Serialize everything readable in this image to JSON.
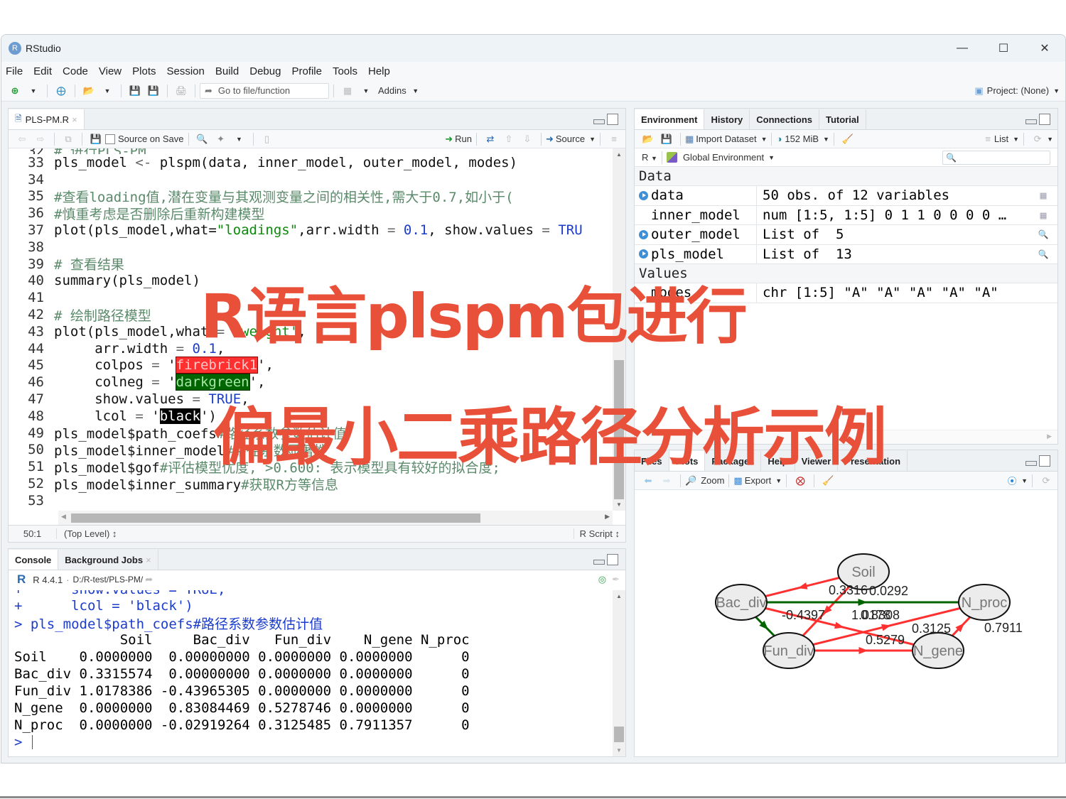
{
  "window": {
    "title": "RStudio",
    "controls": [
      "minimize",
      "maximize",
      "close"
    ]
  },
  "menu": [
    "File",
    "Edit",
    "Code",
    "View",
    "Plots",
    "Session",
    "Build",
    "Debug",
    "Profile",
    "Tools",
    "Help"
  ],
  "toolbar": {
    "goto_placeholder": "Go to file/function",
    "addins_label": "Addins",
    "project_label": "Project: (None)"
  },
  "editor": {
    "tab_label": "PLS-PM.R",
    "source_on_save": "Source on Save",
    "run_label": "Run",
    "source_label": "Source",
    "partial_first_line": "# 进行PLS-PM",
    "lines": [
      {
        "n": "33",
        "segments": [
          [
            "plain",
            "pls_model "
          ],
          [
            "op",
            "<-"
          ],
          [
            "plain",
            " plspm(data, inner_model, outer_model, modes)"
          ]
        ]
      },
      {
        "n": "34",
        "segments": []
      },
      {
        "n": "35",
        "segments": [
          [
            "com",
            "#查看loading值,潜在变量与其观测变量之间的相关性,需大于0.7,如小于("
          ]
        ]
      },
      {
        "n": "36",
        "segments": [
          [
            "com",
            "#慎重考虑是否删除后重新构建模型"
          ]
        ]
      },
      {
        "n": "37",
        "segments": [
          [
            "plain",
            "plot(pls_model,what="
          ],
          [
            "str",
            "\"loadings\""
          ],
          [
            "plain",
            ",arr.width "
          ],
          [
            "op",
            "="
          ],
          [
            "plain",
            " "
          ],
          [
            "num",
            "0.1"
          ],
          [
            "plain",
            ", show.values "
          ],
          [
            "op",
            "="
          ],
          [
            "plain",
            " "
          ],
          [
            "kw",
            "TRU"
          ]
        ]
      },
      {
        "n": "38",
        "segments": []
      },
      {
        "n": "39",
        "segments": [
          [
            "com",
            "# 查看结果"
          ]
        ]
      },
      {
        "n": "40",
        "segments": [
          [
            "plain",
            "summary(pls_model)"
          ]
        ]
      },
      {
        "n": "41",
        "segments": []
      },
      {
        "n": "42",
        "segments": [
          [
            "com",
            "# 绘制路径模型"
          ]
        ]
      },
      {
        "n": "43",
        "segments": [
          [
            "plain",
            "plot(pls_model,what "
          ],
          [
            "op",
            "="
          ],
          [
            "plain",
            " "
          ],
          [
            "str",
            "'weight'"
          ],
          [
            "plain",
            ","
          ]
        ]
      },
      {
        "n": "44",
        "segments": [
          [
            "plain",
            "     arr.width "
          ],
          [
            "op",
            "="
          ],
          [
            "plain",
            " "
          ],
          [
            "num",
            "0.1"
          ],
          [
            "plain",
            ","
          ]
        ]
      },
      {
        "n": "45",
        "segments": [
          [
            "plain",
            "     colpos "
          ],
          [
            "op",
            "="
          ],
          [
            "plain",
            " '"
          ],
          [
            "hlred",
            "firebrick1"
          ],
          [
            "plain",
            "',"
          ]
        ]
      },
      {
        "n": "46",
        "segments": [
          [
            "plain",
            "     colneg "
          ],
          [
            "op",
            "="
          ],
          [
            "plain",
            " '"
          ],
          [
            "hlgreen",
            "darkgreen"
          ],
          [
            "plain",
            "',"
          ]
        ]
      },
      {
        "n": "47",
        "segments": [
          [
            "plain",
            "     show.values "
          ],
          [
            "op",
            "="
          ],
          [
            "plain",
            " "
          ],
          [
            "kw",
            "TRUE"
          ],
          [
            "plain",
            ","
          ]
        ]
      },
      {
        "n": "48",
        "segments": [
          [
            "plain",
            "     lcol "
          ],
          [
            "op",
            "="
          ],
          [
            "plain",
            " '"
          ],
          [
            "hlblack",
            "black"
          ],
          [
            "plain",
            "')"
          ]
        ]
      },
      {
        "n": "49",
        "segments": [
          [
            "plain",
            "pls_model$path_coefs"
          ],
          [
            "com",
            "#路径系数参数估计值"
          ]
        ]
      },
      {
        "n": "50",
        "segments": [
          [
            "plain",
            "pls_model$inner_model"
          ],
          [
            "com",
            "#路径系数显著性"
          ]
        ]
      },
      {
        "n": "51",
        "segments": [
          [
            "plain",
            "pls_model$gof"
          ],
          [
            "com",
            "#评估模型优度, >0.600: 表示模型具有较好的拟合度;"
          ]
        ]
      },
      {
        "n": "52",
        "segments": [
          [
            "plain",
            "pls_model$inner_summary"
          ],
          [
            "com",
            "#获取R方等信息"
          ]
        ]
      },
      {
        "n": "53",
        "segments": []
      }
    ],
    "status": {
      "position": "50:1",
      "scope": "(Top Level)",
      "file_type": "R Script"
    }
  },
  "console": {
    "tabs": [
      "Console",
      "Background Jobs"
    ],
    "r_version": "R 4.4.1",
    "working_dir": "D:/R-test/PLS-PM/",
    "lines": [
      {
        "type": "cont",
        "text": "+      show.values = TRUE,"
      },
      {
        "type": "cont",
        "text": "+      lcol = 'black')"
      },
      {
        "type": "cmd",
        "text": "> pls_model$path_coefs#路径系数参数估计值"
      },
      {
        "type": "out",
        "text": "             Soil     Bac_div   Fun_div    N_gene N_proc"
      },
      {
        "type": "out",
        "text": "Soil    0.0000000  0.00000000 0.0000000 0.0000000      0"
      },
      {
        "type": "out",
        "text": "Bac_div 0.3315574  0.00000000 0.0000000 0.0000000      0"
      },
      {
        "type": "out",
        "text": "Fun_div 1.0178386 -0.43965305 0.0000000 0.0000000      0"
      },
      {
        "type": "out",
        "text": "N_gene  0.0000000  0.83084469 0.5278746 0.0000000      0"
      },
      {
        "type": "out",
        "text": "N_proc  0.0000000 -0.02919264 0.3125485 0.7911357      0"
      },
      {
        "type": "prompt",
        "text": "> "
      }
    ]
  },
  "environment": {
    "tabs": [
      "Environment",
      "History",
      "Connections",
      "Tutorial"
    ],
    "import_label": "Import Dataset",
    "memory_label": "152 MiB",
    "view_mode": "List",
    "language": "R",
    "scope": "Global Environment",
    "search_placeholder": "",
    "sections": [
      {
        "title": "Data",
        "rows": [
          {
            "name": "data",
            "value": "50 obs. of 12 variables",
            "expand": true,
            "action": "grid"
          },
          {
            "name": "inner_model",
            "value": "num [1:5, 1:5] 0 1 1 0 0 0 0 …",
            "expand": false,
            "action": "grid"
          },
          {
            "name": "outer_model",
            "value": "List of  5",
            "expand": true,
            "action": "search"
          },
          {
            "name": "pls_model",
            "value": "List of  13",
            "expand": true,
            "action": "search"
          }
        ]
      },
      {
        "title": "Values",
        "rows": [
          {
            "name": "modes",
            "value": "chr [1:5] \"A\" \"A\" \"A\" \"A\" \"A\"",
            "expand": false,
            "action": ""
          }
        ]
      }
    ]
  },
  "files_pane": {
    "tabs": [
      "Files",
      "Plots",
      "Packages",
      "Help",
      "Viewer",
      "Presentation"
    ],
    "active_tab": "Plots",
    "zoom_label": "Zoom",
    "export_label": "Export"
  },
  "path_diagram": {
    "nodes": [
      "Soil",
      "Bac_div",
      "Fun_div",
      "N_gene",
      "N_proc"
    ],
    "colors": {
      "positive": "#ff3030",
      "negative": "#006400",
      "node_fill": "#ececec"
    },
    "edges": [
      {
        "from": "Soil",
        "to": "Bac_div",
        "value": "0.3316",
        "sign": "pos"
      },
      {
        "from": "Soil",
        "to": "Fun_div",
        "value": "1.0178",
        "sign": "pos"
      },
      {
        "from": "Bac_div",
        "to": "Fun_div",
        "value": "-0.4397",
        "sign": "neg"
      },
      {
        "from": "Bac_div",
        "to": "N_gene",
        "value": "0.8308",
        "sign": "pos"
      },
      {
        "from": "Bac_div",
        "to": "N_proc",
        "value": "0.0292",
        "sign": "neg"
      },
      {
        "from": "Fun_div",
        "to": "N_gene",
        "value": "0.5279",
        "sign": "pos"
      },
      {
        "from": "Fun_div",
        "to": "N_proc",
        "value": "0.3125",
        "sign": "pos"
      },
      {
        "from": "N_gene",
        "to": "N_proc",
        "value": "0.7911",
        "sign": "pos"
      }
    ]
  },
  "overlay": {
    "line1": "R语言plspm包进行",
    "line2": "偏最小二乘路径分析示例",
    "color": "#e8503a"
  }
}
